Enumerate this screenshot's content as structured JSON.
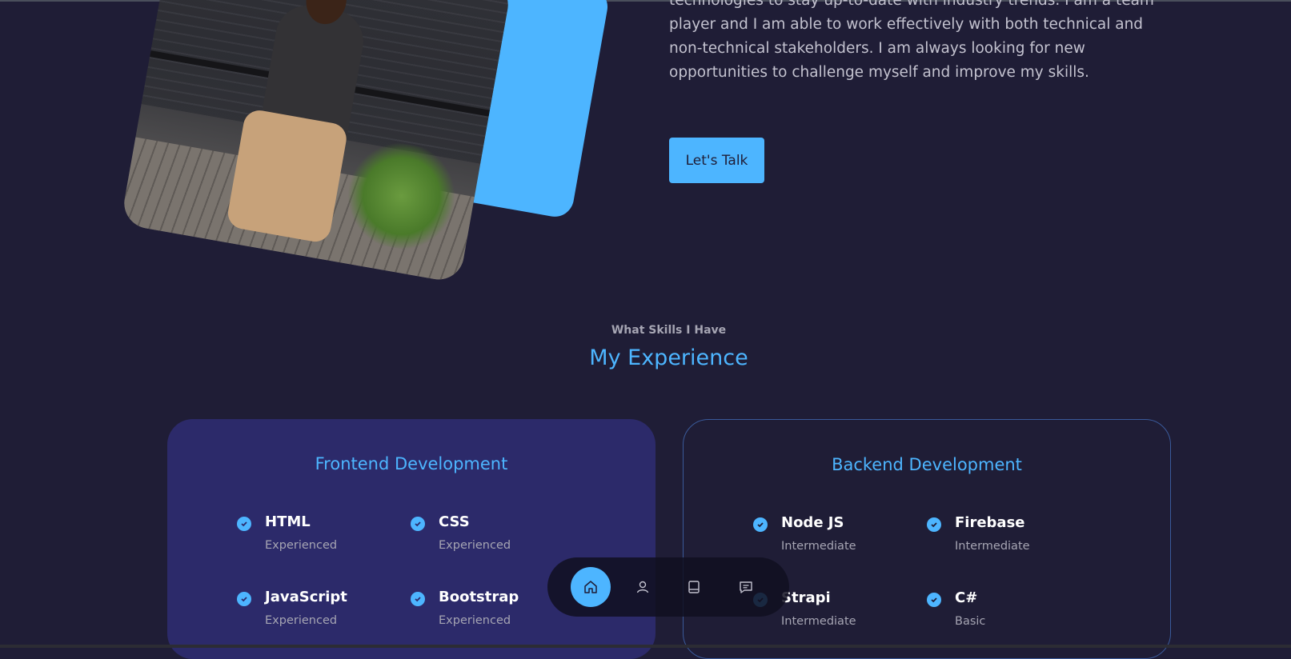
{
  "about": {
    "text": "technologies to stay up-to-date with industry trends. I am a team player and I am able to work effectively with both technical and non-technical stakeholders. I am always looking for new opportunities to challenge myself and improve my skills.",
    "cta_label": "Let's Talk"
  },
  "experience": {
    "subtitle": "What Skills I Have",
    "title": "My Experience",
    "frontend": {
      "title": "Frontend Development",
      "skills": [
        {
          "name": "HTML",
          "level": "Experienced"
        },
        {
          "name": "CSS",
          "level": "Experienced"
        },
        {
          "name": "JavaScript",
          "level": "Experienced"
        },
        {
          "name": "Bootstrap",
          "level": "Experienced"
        }
      ]
    },
    "backend": {
      "title": "Backend Development",
      "skills": [
        {
          "name": "Node JS",
          "level": "Intermediate"
        },
        {
          "name": "Firebase",
          "level": "Intermediate"
        },
        {
          "name": "Strapi",
          "level": "Intermediate"
        },
        {
          "name": "C#",
          "level": "Basic"
        }
      ]
    }
  },
  "nav": {
    "items": [
      {
        "icon": "home-icon",
        "active": true
      },
      {
        "icon": "user-icon",
        "active": false
      },
      {
        "icon": "book-icon",
        "active": false
      },
      {
        "icon": "message-icon",
        "active": false
      }
    ]
  },
  "colors": {
    "background": "#1f1d36",
    "accent": "#4db5ff",
    "card": "#2c2a6a"
  }
}
